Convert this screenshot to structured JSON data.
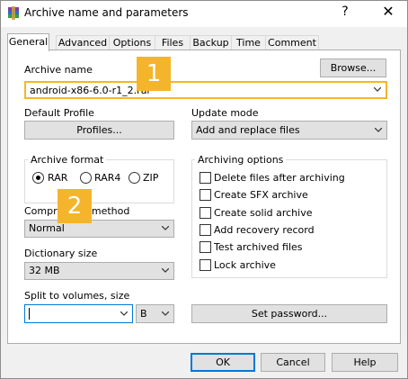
{
  "window": {
    "title": "Archive name and parameters",
    "help_glyph": "?",
    "close_glyph": "✕"
  },
  "tabs": [
    "General",
    "Advanced",
    "Options",
    "Files",
    "Backup",
    "Time",
    "Comment"
  ],
  "general": {
    "archive_name_label": "Archive name",
    "browse_button": "Browse...",
    "archive_name_value": "android-x86-6.0-r1_2.rar",
    "default_profile_label": "Default Profile",
    "profiles_button": "Profiles...",
    "update_mode_label": "Update mode",
    "update_mode_value": "Add and replace files",
    "archive_format": {
      "title": "Archive format",
      "options": [
        "RAR",
        "RAR4",
        "ZIP"
      ],
      "selected": "RAR"
    },
    "compression_method_label": "Compression method",
    "compression_method_value": "Normal",
    "dictionary_size_label": "Dictionary size",
    "dictionary_size_value": "32 MB",
    "split_label": "Split to volumes, size",
    "split_value": "",
    "split_unit": "B",
    "archiving_options": {
      "title": "Archiving options",
      "items": [
        "Delete files after archiving",
        "Create SFX archive",
        "Create solid archive",
        "Add recovery record",
        "Test archived files",
        "Lock archive"
      ],
      "checked": [
        false,
        false,
        false,
        false,
        false,
        false
      ]
    },
    "set_password_button": "Set password..."
  },
  "buttons": {
    "ok": "OK",
    "cancel": "Cancel",
    "help": "Help"
  },
  "annotations": {
    "badge_1": "1",
    "badge_2": "2",
    "accent": "#f4b52c"
  }
}
